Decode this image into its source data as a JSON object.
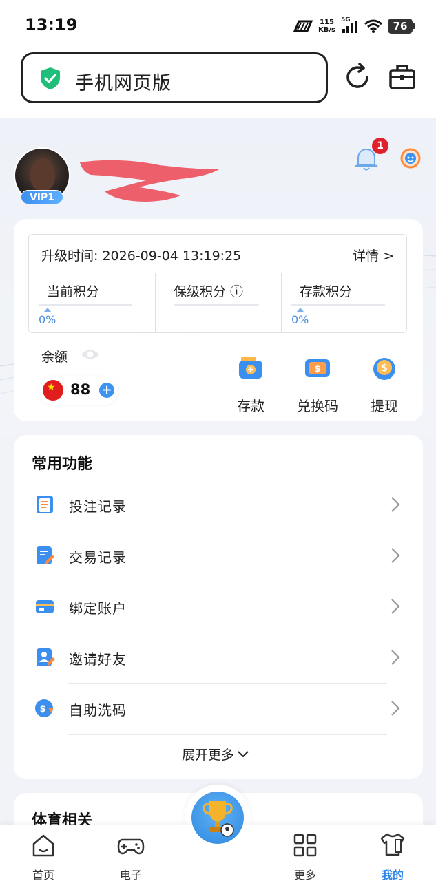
{
  "status_bar": {
    "time": "13:19",
    "net_speed_value": "115",
    "net_speed_unit": "KB/s",
    "network": "5G",
    "battery": "76"
  },
  "address_bar": {
    "title": "手机网页版"
  },
  "profile": {
    "vip_label": "VIP1",
    "notification_count": "1"
  },
  "upgrade": {
    "label": "升级时间:",
    "time": "2026-09-04 13:19:25",
    "details_label": "详情 >",
    "scores": [
      {
        "title": "当前积分",
        "percent": "0%"
      },
      {
        "title": "保级积分 ⓘ",
        "percent": ""
      },
      {
        "title": "存款积分",
        "percent": "0%"
      }
    ]
  },
  "wallet": {
    "balance_label": "余额",
    "balance_value": "88",
    "actions": [
      {
        "label": "存款",
        "icon": "deposit-icon"
      },
      {
        "label": "兑换码",
        "icon": "voucher-icon"
      },
      {
        "label": "提现",
        "icon": "withdraw-icon"
      }
    ]
  },
  "common_functions": {
    "title": "常用功能",
    "items": [
      {
        "label": "投注记录",
        "icon": "bet-record-icon"
      },
      {
        "label": "交易记录",
        "icon": "transaction-record-icon"
      },
      {
        "label": "绑定账户",
        "icon": "bind-account-icon"
      },
      {
        "label": "邀请好友",
        "icon": "invite-friend-icon"
      },
      {
        "label": "自助洗码",
        "icon": "self-rebate-icon"
      }
    ],
    "expand_label": "展开更多"
  },
  "sports_section": {
    "title": "体育相关"
  },
  "tab_bar": {
    "tabs": [
      {
        "label": "首页",
        "icon": "home-icon"
      },
      {
        "label": "电子",
        "icon": "gamepad-icon"
      },
      {
        "label": "更多",
        "icon": "grid-icon"
      },
      {
        "label": "我的",
        "icon": "profile-shirt-icon"
      }
    ],
    "active_color": "#2f86e8"
  },
  "colors": {
    "accent": "#3b93f2",
    "badge": "#e0202a",
    "shield": "#1fbf7a"
  }
}
